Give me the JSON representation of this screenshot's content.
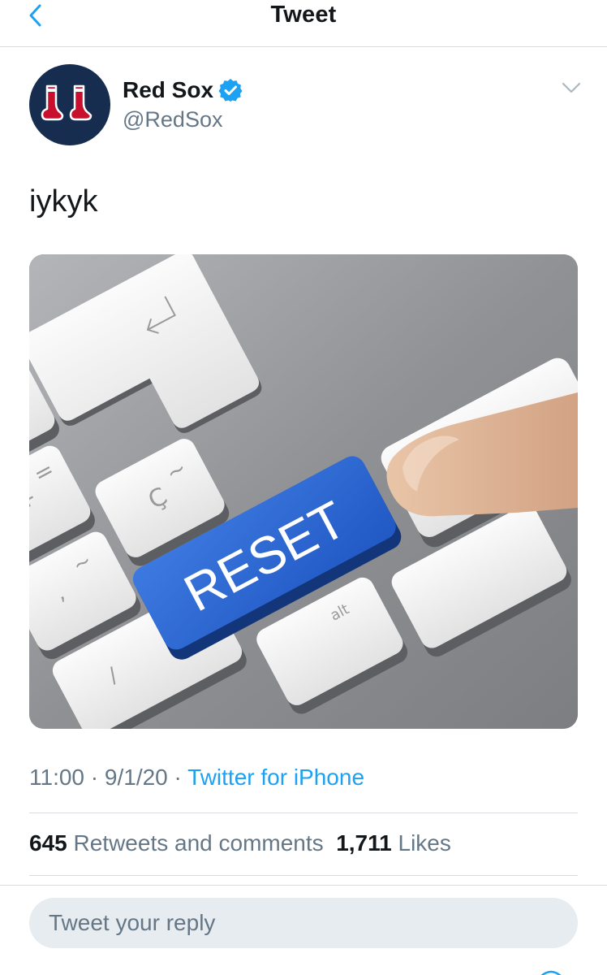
{
  "nav": {
    "title": "Tweet",
    "back_icon": "chevron-left-icon"
  },
  "tweet": {
    "author": {
      "name": "Red Sox",
      "handle": "@RedSox",
      "verified": true,
      "avatar_icon": "red-sox-logo"
    },
    "text": "iykyk",
    "media": {
      "key_label": "RESET",
      "alt_key_label": "alt"
    },
    "time": "11:00",
    "date": "9/1/20",
    "source": "Twitter for iPhone",
    "separator": "·",
    "retweets_count": "645",
    "retweets_label": "Retweets and comments",
    "likes_count": "1,711",
    "likes_label": "Likes"
  },
  "reply": {
    "placeholder": "Tweet your reply"
  },
  "colors": {
    "accent": "#1da1f2",
    "secondary_text": "#657786",
    "avatar_bg": "#162d4f",
    "sock_red": "#c8102e"
  }
}
